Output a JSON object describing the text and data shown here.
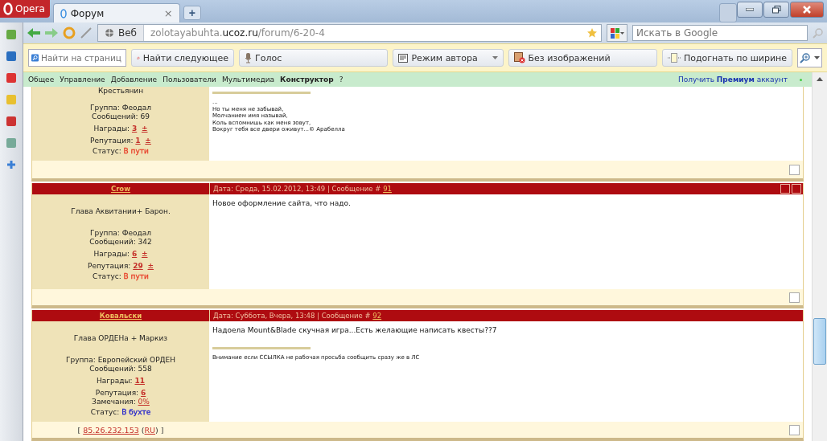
{
  "browser": {
    "menu_button": "Opera",
    "tabs": [
      {
        "title": "Форум",
        "close": "×",
        "selected": true
      }
    ],
    "new_tab": "+",
    "address": {
      "mode": "Веб",
      "url_parts": [
        {
          "text": "zolotayabuhta.",
          "kind": "rest"
        },
        {
          "text": "ucoz.ru",
          "kind": "host"
        },
        {
          "text": "/forum/6-20-4",
          "kind": "rest"
        }
      ]
    },
    "search": {
      "placeholder": "Искать в Google"
    },
    "toolbar": [
      {
        "kind": "field",
        "placeholder": "Найти на страниц"
      },
      {
        "kind": "button",
        "label": "Найти следующее"
      },
      {
        "kind": "button",
        "label": "Голос"
      },
      {
        "kind": "dropdown",
        "label": "Режим автора"
      },
      {
        "kind": "button",
        "label": "Без изображений"
      },
      {
        "kind": "button",
        "label": "Подогнать по ширине"
      },
      {
        "kind": "zoom"
      }
    ]
  },
  "ucoz_bar": {
    "items": [
      {
        "label": "Общее",
        "selected": false
      },
      {
        "label": "Управление",
        "selected": false
      },
      {
        "label": "Добавление",
        "selected": false
      },
      {
        "label": "Пользователи",
        "selected": false
      },
      {
        "label": "Мультимедиа",
        "selected": false
      },
      {
        "label": "Конструктор",
        "selected": true
      },
      {
        "label": "?",
        "selected": false
      }
    ],
    "premium": "Получить **Премиум** аккаунт"
  },
  "posts": [
    {
      "rank": "Крестьянин",
      "group": "Группа: Феодал",
      "messages": "Сообщений: 69",
      "stats": [
        {
          "kind": "count",
          "label": "Награды:",
          "value": "3",
          "plus": "±"
        },
        {
          "kind": "count",
          "label": "Репутация:",
          "value": "1",
          "plus": "±"
        }
      ],
      "status": {
        "label": "Статус:",
        "value": "В пути",
        "color": "#e8402a"
      },
      "signature": [
        "...",
        "Но ты меня не забывай,",
        "Молчанием имя называй,",
        "Коль вспомнишь как меня зовут,",
        "Вокруг тебя все двери оживут...© Арабелла"
      ],
      "checked": false
    },
    {
      "author": "Crow",
      "date": "Дата: Среда, 15.02.2012, 13:49 | Сообщение # ",
      "number": "91",
      "actions": true,
      "rank": "Глава Аквитании+ Барон.",
      "group": "Группа: Феодал",
      "messages": "Сообщений: 342",
      "stats": [
        {
          "kind": "count",
          "label": "Награды:",
          "value": "6",
          "plus": "±"
        },
        {
          "kind": "count",
          "label": "Репутация:",
          "value": "29",
          "plus": "±"
        }
      ],
      "status": {
        "label": "Статус:",
        "value": "В пути",
        "color": "#e8402a"
      },
      "message": "Новое оформление сайта, что надо.",
      "checked": false
    },
    {
      "author": "Ковальски",
      "date": "Дата: Суббота, Вчера, 13:48 | Сообщение # ",
      "number": "92",
      "actions": false,
      "rank": "Глава ОРДЕНа + Маркиз",
      "group": "Группа: Европейский ОРДЕН",
      "messages": "Сообщений: 558",
      "stats": [
        {
          "kind": "count",
          "label": "Награды:",
          "value": "11"
        },
        {
          "kind": "count",
          "label": "Репутация:",
          "value": "6"
        },
        {
          "kind": "percent",
          "label": "Замечания:",
          "value": "0%"
        }
      ],
      "status": {
        "label": "Статус:",
        "value": "В бухте",
        "color": "#2020cc"
      },
      "message": "Надоела Mount&Blade скучная игра...Есть желающие написать квесты??7",
      "signature": [
        "Внимание если ССЫЛКА не рабочая просьба сообщить сразу же в ЛС"
      ],
      "footer": [
        {
          "kind": "text",
          "text": "[ "
        },
        {
          "kind": "link",
          "text": "85.26.232.153"
        },
        {
          "kind": "text",
          "text": " ("
        },
        {
          "kind": "link",
          "text": "RU"
        },
        {
          "kind": "text",
          "text": ") ]"
        }
      ],
      "checked": false
    }
  ]
}
